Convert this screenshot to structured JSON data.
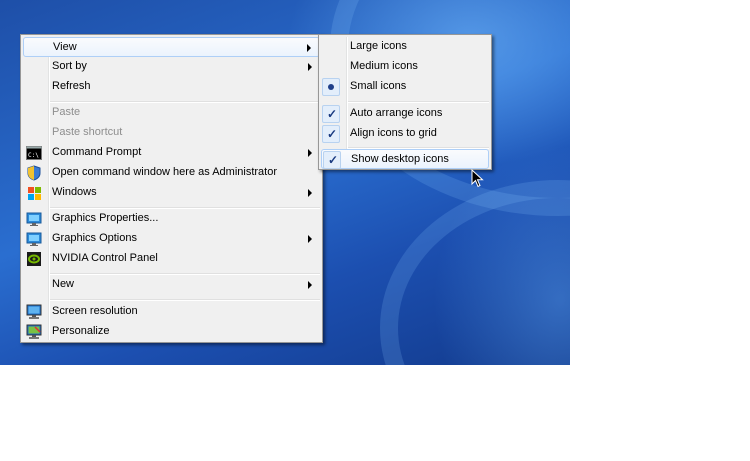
{
  "context_menu": {
    "items": [
      {
        "label": "View",
        "submenu": true,
        "icon": "",
        "disabled": false
      },
      {
        "label": "Sort by",
        "submenu": true,
        "icon": "",
        "disabled": false
      },
      {
        "label": "Refresh",
        "submenu": false,
        "icon": "",
        "disabled": false
      },
      {
        "label": "Paste",
        "submenu": false,
        "icon": "",
        "disabled": true
      },
      {
        "label": "Paste shortcut",
        "submenu": false,
        "icon": "",
        "disabled": true
      },
      {
        "label": "Command Prompt",
        "submenu": true,
        "icon": "command-prompt-icon",
        "disabled": false
      },
      {
        "label": "Open command window here as Administrator",
        "submenu": false,
        "icon": "shield-icon",
        "disabled": false
      },
      {
        "label": "Windows",
        "submenu": true,
        "icon": "windows-logo-icon",
        "disabled": false
      },
      {
        "label": "Graphics Properties...",
        "submenu": false,
        "icon": "graphics-properties-icon",
        "disabled": false
      },
      {
        "label": "Graphics Options",
        "submenu": true,
        "icon": "graphics-options-icon",
        "disabled": false
      },
      {
        "label": "NVIDIA Control Panel",
        "submenu": false,
        "icon": "nvidia-icon",
        "disabled": false
      },
      {
        "label": "New",
        "submenu": true,
        "icon": "",
        "disabled": false
      },
      {
        "label": "Screen resolution",
        "submenu": false,
        "icon": "monitor-icon",
        "disabled": false
      },
      {
        "label": "Personalize",
        "submenu": false,
        "icon": "personalize-icon",
        "disabled": false
      }
    ]
  },
  "view_submenu": {
    "items": [
      {
        "label": "Large icons",
        "state": "none"
      },
      {
        "label": "Medium icons",
        "state": "none"
      },
      {
        "label": "Small icons",
        "state": "radio"
      },
      {
        "label": "Auto arrange icons",
        "state": "check"
      },
      {
        "label": "Align icons to grid",
        "state": "check"
      },
      {
        "label": "Show desktop icons",
        "state": "check"
      }
    ],
    "check_glyph": "✓"
  },
  "colors": {
    "menu_background": "#f0f0f0",
    "highlight_border": "#aecff7",
    "desktop_blue": "#1e4fa8"
  }
}
